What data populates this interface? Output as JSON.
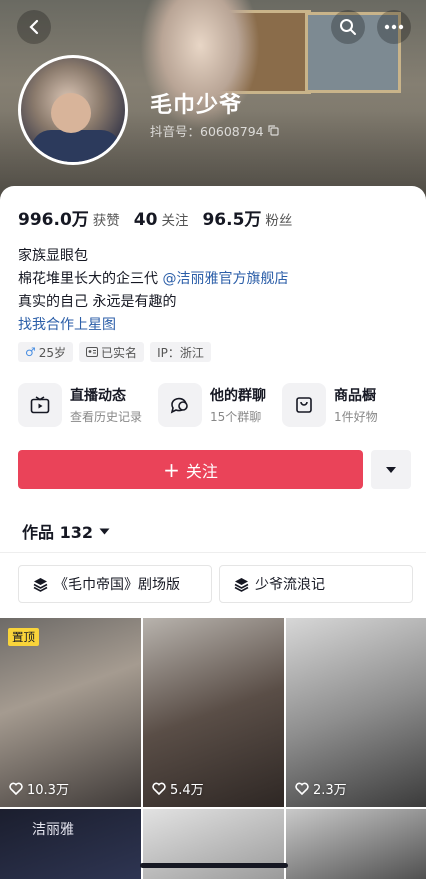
{
  "profile": {
    "nickname": "毛巾少爷",
    "douyin_id": "抖音号：60608794"
  },
  "stats": [
    {
      "value": "996.0万",
      "label": "获赞"
    },
    {
      "value": "40",
      "label": "关注"
    },
    {
      "value": "96.5万",
      "label": "粉丝"
    }
  ],
  "bio": {
    "line1": "家族显眼包",
    "line2_text": "棉花堆里长大的企三代 ",
    "line2_mention": "@洁丽雅官方旗舰店",
    "line3": "真实的自己 永远是有趣的",
    "line4_link": "找我合作上星图"
  },
  "tags": {
    "age": "25岁",
    "verified": "已实名",
    "ip": "IP：浙江"
  },
  "features": [
    {
      "title": "直播动态",
      "sub": "查看历史记录",
      "icon": "tv-icon"
    },
    {
      "title": "他的群聊",
      "sub": "15个群聊",
      "icon": "chat-icon"
    },
    {
      "title": "商品橱",
      "sub": "1件好物",
      "icon": "bag-icon"
    }
  ],
  "follow": {
    "label": "关注"
  },
  "works": {
    "label": "作品 132"
  },
  "collections": [
    {
      "label": "《毛巾帝国》剧场版"
    },
    {
      "label": "少爷流浪记"
    }
  ],
  "videos": [
    {
      "likes": "10.3万",
      "pinned": "置顶"
    },
    {
      "likes": "5.4万"
    },
    {
      "likes": "2.3万"
    }
  ],
  "tile_brand": "洁丽雅",
  "colors": {
    "accent": "#ea4359",
    "link": "#2b5ea8",
    "pin": "#f9d43a"
  }
}
